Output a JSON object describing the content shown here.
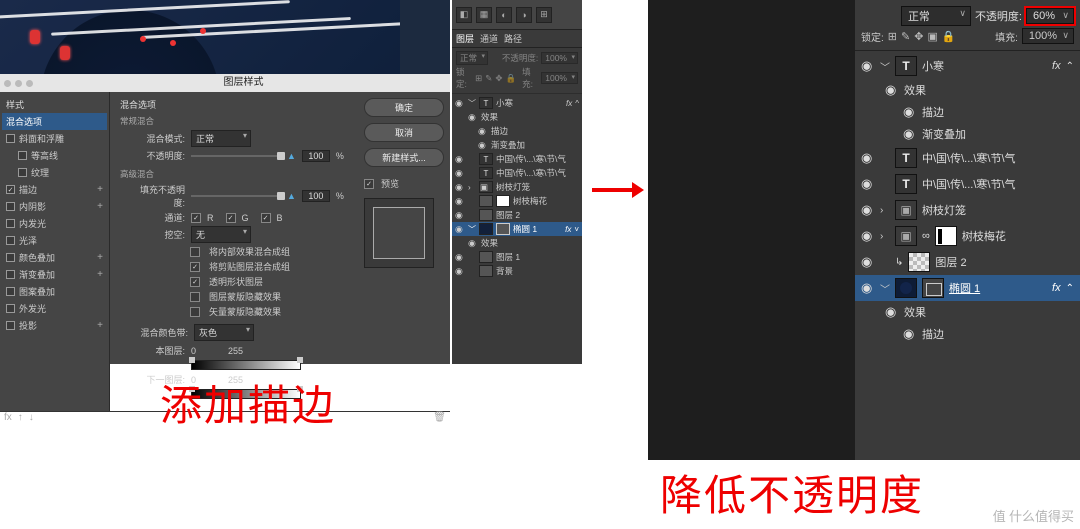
{
  "annotations": {
    "left": "添加描边",
    "right": "降低不透明度"
  },
  "dialog": {
    "title": "图层样式",
    "styles_header": "样式",
    "styles": {
      "blend_options": "混合选项",
      "bevel": "斜面和浮雕",
      "contour": "等高线",
      "texture": "纹理",
      "stroke": "描边",
      "inner_shadow": "内阴影",
      "inner_glow": "内发光",
      "satin": "光泽",
      "color_overlay": "颜色叠加",
      "grad_overlay": "渐变叠加",
      "pattern_overlay": "图案叠加",
      "outer_glow": "外发光",
      "drop_shadow": "投影",
      "plus": "+"
    },
    "center": {
      "section": "混合选项",
      "general": "常规混合",
      "mode_label": "混合模式:",
      "mode_value": "正常",
      "opacity_label": "不透明度:",
      "opacity_value": "100",
      "pct": "%",
      "advanced": "高级混合",
      "fill_label": "填充不透明度:",
      "fill_value": "100",
      "channels_label": "通道:",
      "ch_r": "R",
      "ch_g": "G",
      "ch_b": "B",
      "knockout_label": "挖空:",
      "knockout_value": "无",
      "ck1": "将内部效果混合成组",
      "ck2": "将剪贴图层混合成组",
      "ck3": "透明形状图层",
      "ck4": "图层蒙版隐藏效果",
      "ck5": "矢量蒙版隐藏效果",
      "blendif_label": "混合颜色带:",
      "blendif_value": "灰色",
      "this_layer": "本图层:",
      "under_layer": "下一图层:",
      "range_lo": "0",
      "range_hi": "255"
    },
    "buttons": {
      "ok": "确定",
      "cancel": "取消",
      "new_style": "新建样式...",
      "preview": "预览"
    },
    "footer_fx": "fx"
  },
  "mini": {
    "tab_layers": "图层",
    "tab_channels": "通道",
    "tab_paths": "路径",
    "mode": "正常",
    "opacity_label": "不透明度:",
    "opacity_value": "100%",
    "lock_label": "锁定:",
    "fill_label": "填充:",
    "fill_value": "100%",
    "layers": {
      "l1": "小寒",
      "fx": "fx",
      "fx_sub": "效果",
      "fx_stroke": "描边",
      "fx_grad": "渐变叠加",
      "l2": "中国\\传\\...\\寒\\节\\气",
      "l3": "中国\\传\\...\\寒\\节\\气",
      "g1": "树枝灯笼",
      "g1_inner": "树枝梅花",
      "l4": "图层 2",
      "l5": "椭圆 1",
      "l5_fx": "效果",
      "l6": "图层 1",
      "l7": "背景"
    }
  },
  "rp": {
    "mode": "正常",
    "opacity_label": "不透明度:",
    "opacity_value": "60%",
    "lock_label": "锁定:",
    "fill_label": "填充:",
    "fill_value": "100%",
    "layers": {
      "l1": "小寒",
      "fx": "fx",
      "fx_sub": "效果",
      "fx_stroke": "描边",
      "fx_grad": "渐变叠加",
      "l2": "中\\国\\传\\...\\寒\\节\\气",
      "l3": "中\\国\\传\\...\\寒\\节\\气",
      "g1": "树枝灯笼",
      "g2": "树枝梅花",
      "l4": "图层 2",
      "l5": "椭圆 1",
      "l5_fx_sub": "效果",
      "l5_fx_stroke": "描边"
    }
  },
  "icons": {
    "eye": "◉",
    "caret_down": "﹀",
    "caret_right": "›",
    "folder": "▣",
    "lock": "🔒",
    "T": "T",
    "check": "✓",
    "chain": "∞",
    "trash": "🗑"
  },
  "watermark": "值 什么值得买"
}
